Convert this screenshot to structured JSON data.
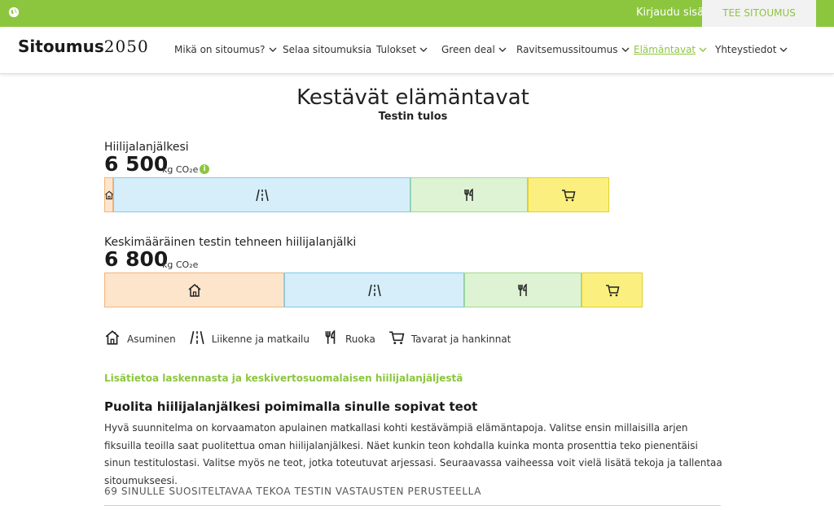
{
  "topbar": {
    "login_label": "Kirjaudu sisään",
    "cta_label": "TEE SITOUMUS",
    "globe_icon": "globe-icon",
    "bg_color": "#8cc63f"
  },
  "brand": {
    "name": "Sitoumus",
    "year": "2050"
  },
  "nav": {
    "items": [
      {
        "label": "Mikä on sitoumus?",
        "dropdown": true
      },
      {
        "label": "Selaa sitoumuksia",
        "dropdown": false
      },
      {
        "label": "Tulokset",
        "dropdown": true
      },
      {
        "label": "Green deal",
        "dropdown": true
      },
      {
        "label": "Ravitsemussitoumus",
        "dropdown": true
      },
      {
        "label": "Elämäntavat",
        "dropdown": true,
        "active": true
      },
      {
        "label": "Yhteystiedot",
        "dropdown": true
      }
    ]
  },
  "page": {
    "title": "Kestävät elämäntavat",
    "subtitle": "Testin tulos"
  },
  "footprint": {
    "title": "Hiilijalanjälkesi",
    "value": "6 500",
    "unit": "kg CO₂e",
    "info_icon": "info-icon",
    "info_glyph": "i",
    "segments": [
      {
        "category": "house",
        "icon": "house-icon",
        "value": 100
      },
      {
        "category": "traffic",
        "icon": "road-icon",
        "value": 3300
      },
      {
        "category": "food",
        "icon": "fork-knife-icon",
        "value": 1300
      },
      {
        "category": "goods",
        "icon": "cart-icon",
        "value": 900
      }
    ]
  },
  "average": {
    "title": "Keskimääräinen testin tehneen hiilijalanjälki",
    "value": "6 800",
    "unit": "kg CO₂e",
    "segments": [
      {
        "category": "house",
        "icon": "house-icon",
        "value": 2000
      },
      {
        "category": "traffic",
        "icon": "road-icon",
        "value": 2000
      },
      {
        "category": "food",
        "icon": "fork-knife-icon",
        "value": 1300
      },
      {
        "category": "goods",
        "icon": "cart-icon",
        "value": 680
      }
    ]
  },
  "legend": [
    {
      "icon": "house-icon",
      "label": "Asuminen"
    },
    {
      "icon": "road-icon",
      "label": "Liikenne ja matkailu"
    },
    {
      "icon": "fork-knife-icon",
      "label": "Ruoka"
    },
    {
      "icon": "cart-icon",
      "label": "Tavarat ja hankinnat"
    }
  ],
  "more_info_link": "Lisätietoa laskennasta ja keskivertosuomalaisen hiilijalanjäljestä",
  "section": {
    "title": "Puolita hiilijalanjälkesi poimimalla sinulle sopivat teot",
    "body": "Hyvä suunnitelma on korvaamaton apulainen matkallasi kohti kestävämpiä elämäntapoja. Valitse ensin millaisilla arjen fiksuilla teoilla saat puolitettua oman hiilijalanjälkesi. Näet kunkin teon kohdalla kuinka monta prosenttia teko pienentäisi sinun testitulostasi. Valitse myös ne teot, jotka toteutuvat arjessasi. Seuraavassa vaiheessa voit vielä lisätä tekoja ja tallentaa sitoumukseesi.",
    "recommendations": "69 SINULLE SUOSITELTAVAA TEKOA TESTIN VASTAUSTEN PERUSTEELLA"
  },
  "colors": {
    "accent": "#8cc63f",
    "house": "#fde5cc",
    "traffic": "#d5eefa",
    "food": "#def3d3",
    "goods": "#fbf07f"
  }
}
